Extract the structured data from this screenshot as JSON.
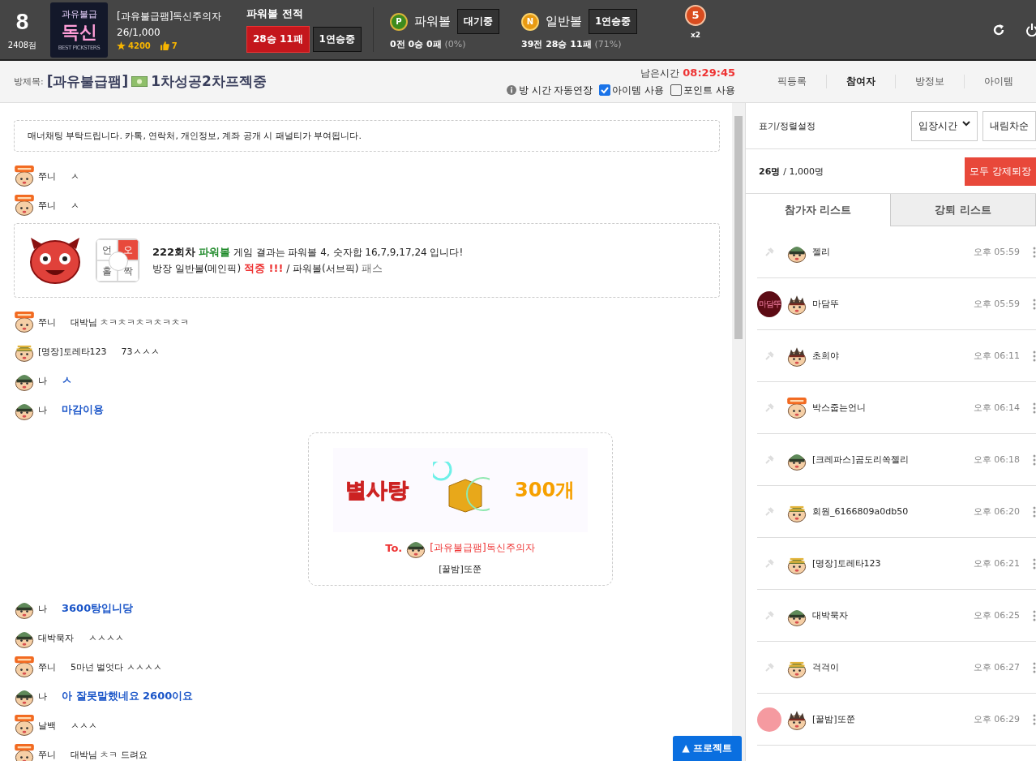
{
  "header": {
    "level": "8",
    "points": "2408점",
    "logo": {
      "top": "과유불급",
      "main": "독신",
      "sub": "BEST PICKSTERS"
    },
    "user": {
      "name": "[과유불급팸]독신주의자",
      "count": "26/1,000",
      "stars": "4200",
      "likes": "7"
    },
    "record": {
      "title": "파워볼 전적",
      "result": "28승 11패",
      "streak": "1연승중"
    },
    "games": [
      {
        "kind": "p",
        "icon": "P",
        "name": "파워볼",
        "status": "대기중",
        "summary": "0전 0승 0패",
        "rate": "(0%)"
      },
      {
        "kind": "n",
        "icon": "N",
        "name": "일반볼",
        "status": "1연승중",
        "summary": "39전 28승 11패",
        "rate": "(71%)"
      }
    ],
    "bonus": {
      "number": "5",
      "multiplier": "x2"
    }
  },
  "room": {
    "label": "방제목:",
    "clan": "[과유불급팸]",
    "title": "1차성공2차프젝중",
    "remaining_label": "남은시간",
    "remaining": "08:29:45",
    "auto_extend": "방 시간 자동연장",
    "options": [
      {
        "label": "아이템 사용",
        "checked": true
      },
      {
        "label": "포인트 사용",
        "checked": false
      }
    ],
    "tabs": [
      {
        "label": "픽등록",
        "selected": false
      },
      {
        "label": "참여자",
        "selected": true
      },
      {
        "label": "방정보",
        "selected": false
      },
      {
        "label": "아이템",
        "selected": false
      }
    ]
  },
  "chat": [
    {
      "kind": "notice",
      "text": "매너채팅 부탁드립니다. 카톡, 연락처, 개인정보, 계좌 공개 시 패널티가 부여됩니다."
    },
    {
      "kind": "chat",
      "avatar": {
        "kind": "new"
      },
      "name": "쭈니",
      "text": "ㅅ",
      "mine": false
    },
    {
      "kind": "chat",
      "avatar": {
        "kind": "new"
      },
      "name": "쭈니",
      "text": "ㅅ",
      "mine": false
    },
    {
      "kind": "result",
      "round": "222회차",
      "game": "파워볼",
      "text": "게임 결과는 파워볼 4, 숫자합 16,7,9,17,24 입니다!",
      "pick_label": "방장 일반볼(메인픽)",
      "pick_result": "적중 !!!",
      "sub_label": "/ 파워볼(서브픽)",
      "sub_result": "패스",
      "grid": [
        {
          "label": "언",
          "selected": false
        },
        {
          "label": "오",
          "selected": true
        },
        {
          "label": "홀",
          "selected": false
        },
        {
          "label": "짝",
          "selected": false
        }
      ]
    },
    {
      "kind": "chat",
      "avatar": {
        "kind": "new"
      },
      "name": "쭈니",
      "text": "대박님 ㅊㅋㅊㅋㅊㅋㅊㅋㅊㅋ",
      "mine": false
    },
    {
      "kind": "chat",
      "avatar": {
        "kind": "stripe"
      },
      "name": "[명장]토레타123",
      "text": "73ㅅㅅㅅ",
      "mine": false
    },
    {
      "kind": "chat",
      "avatar": {
        "kind": "green"
      },
      "name": "나",
      "text": "ㅅ",
      "mine": true
    },
    {
      "kind": "chat",
      "avatar": {
        "kind": "green"
      },
      "name": "나",
      "text": "마감이용",
      "mine": true
    },
    {
      "kind": "gift",
      "item": "별사탕",
      "amount": "300개",
      "to": "To.",
      "recipient": "[과유불급팸]독신주의자",
      "sender": "[꿀밤]또쭌"
    },
    {
      "kind": "chat",
      "avatar": {
        "kind": "green"
      },
      "name": "나",
      "text": "3600탕입니당",
      "mine": true
    },
    {
      "kind": "chat",
      "avatar": {
        "kind": "green"
      },
      "name": "대박묵자",
      "text": "ㅅㅅㅅㅅ",
      "mine": false
    },
    {
      "kind": "chat",
      "avatar": {
        "kind": "new"
      },
      "name": "쭈니",
      "text": "5마넌 벌엇다 ㅅㅅㅅㅅ",
      "mine": false
    },
    {
      "kind": "chat",
      "avatar": {
        "kind": "green"
      },
      "name": "나",
      "text": "아 잘못말했네요 2600이요",
      "mine": true
    },
    {
      "kind": "chat",
      "avatar": {
        "kind": "new"
      },
      "name": "날백",
      "text": "ㅅㅅㅅ",
      "mine": false
    },
    {
      "kind": "chat",
      "avatar": {
        "kind": "new"
      },
      "name": "쭈니",
      "text": "대박님 ㅊㅋ 드려요",
      "mine": false
    }
  ],
  "scroll_button": {
    "arrow": "▲",
    "label": "프로젝트"
  },
  "panel": {
    "sort_label": "표기/정렬설정",
    "sort_by": "입장시간",
    "order": "내림차순",
    "count": "26명",
    "total": "/ 1,000명",
    "kick_all": "모두 강제퇴장",
    "tabs": [
      {
        "label": "참가자 리스트",
        "selected": true
      },
      {
        "label": "강퇴 리스트",
        "selected": false
      }
    ],
    "participants": [
      {
        "badge": {
          "kind": "pin"
        },
        "avatar": {
          "kind": "green"
        },
        "name": "젤리",
        "time": "오후 05:59"
      },
      {
        "badge": {
          "kind": "text",
          "text": "마담뚜"
        },
        "avatar": {
          "kind": "spike"
        },
        "name": "마담뚜",
        "time": "오후 05:59"
      },
      {
        "badge": {
          "kind": "pin"
        },
        "avatar": {
          "kind": "spike"
        },
        "name": "초희야",
        "time": "오후 06:11"
      },
      {
        "badge": {
          "kind": "pin"
        },
        "avatar": {
          "kind": "new"
        },
        "name": "박스줍는언니",
        "time": "오후 06:14"
      },
      {
        "badge": {
          "kind": "pin"
        },
        "avatar": {
          "kind": "green"
        },
        "name": "[크레파스]곰도리쏙젤리",
        "time": "오후 06:18"
      },
      {
        "badge": {
          "kind": "pin"
        },
        "avatar": {
          "kind": "stripe"
        },
        "name": "회원_6166809a0db50",
        "time": "오후 06:20"
      },
      {
        "badge": {
          "kind": "pin"
        },
        "avatar": {
          "kind": "stripe"
        },
        "name": "[명장]토레타123",
        "time": "오후 06:21"
      },
      {
        "badge": {
          "kind": "pin"
        },
        "avatar": {
          "kind": "green"
        },
        "name": "대박묵자",
        "time": "오후 06:25"
      },
      {
        "badge": {
          "kind": "pin"
        },
        "avatar": {
          "kind": "stripe"
        },
        "name": "걱걱이",
        "time": "오후 06:27"
      },
      {
        "badge": {
          "kind": "photo"
        },
        "avatar": {
          "kind": "spike"
        },
        "name": "[꿀밤]또쭌",
        "time": "오후 06:29"
      }
    ]
  }
}
